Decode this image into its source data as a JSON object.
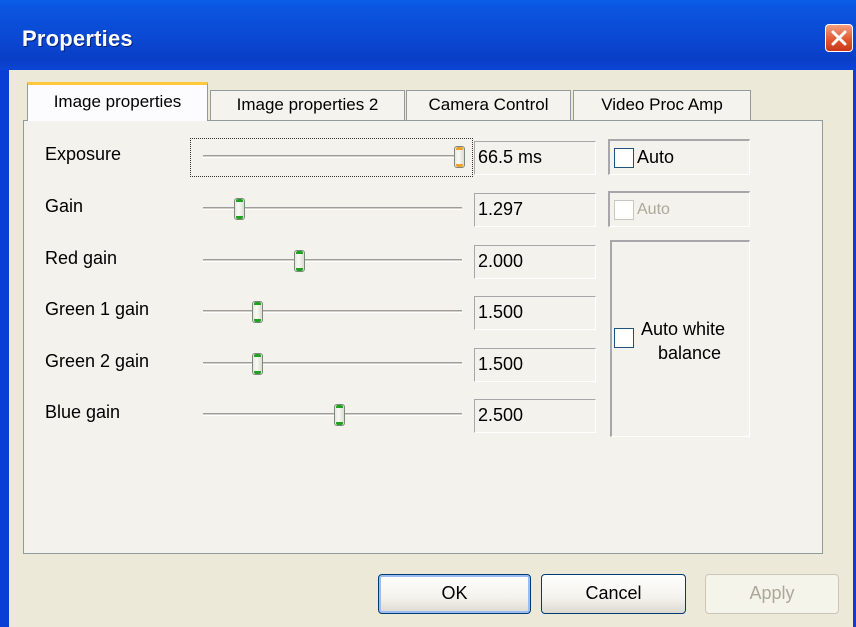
{
  "window": {
    "title": "Properties"
  },
  "tabs": [
    {
      "label": "Image properties",
      "active": true
    },
    {
      "label": "Image properties 2",
      "active": false
    },
    {
      "label": "Camera Control",
      "active": false
    },
    {
      "label": "Video Proc Amp",
      "active": false
    }
  ],
  "controls": {
    "exposure": {
      "label": "Exposure",
      "value": "66.5 ms",
      "slider_fraction": 1.0
    },
    "gain": {
      "label": "Gain",
      "value": "1.297",
      "slider_fraction": 0.12
    },
    "red": {
      "label": "Red gain",
      "value": "2.000",
      "slider_fraction": 0.36
    },
    "green1": {
      "label": "Green 1 gain",
      "value": "1.500",
      "slider_fraction": 0.19
    },
    "green2": {
      "label": "Green 2 gain",
      "value": "1.500",
      "slider_fraction": 0.19
    },
    "blue": {
      "label": "Blue gain",
      "value": "2.500",
      "slider_fraction": 0.52
    }
  },
  "checkboxes": {
    "exposure_auto": {
      "label": "Auto",
      "checked": false,
      "enabled": true
    },
    "gain_auto": {
      "label": "Auto",
      "checked": false,
      "enabled": false
    },
    "auto_white_balance": {
      "label_line1": "Auto white",
      "label_line2": "balance",
      "checked": false,
      "enabled": true
    }
  },
  "buttons": {
    "ok": "OK",
    "cancel": "Cancel",
    "apply": "Apply"
  },
  "colors": {
    "titlebar": "#0a48d2",
    "close": "#e0532b",
    "dialog_bg": "#ece9d8",
    "thumb_accent": "#21a121",
    "thumb_focus_accent": "#f0a030"
  }
}
